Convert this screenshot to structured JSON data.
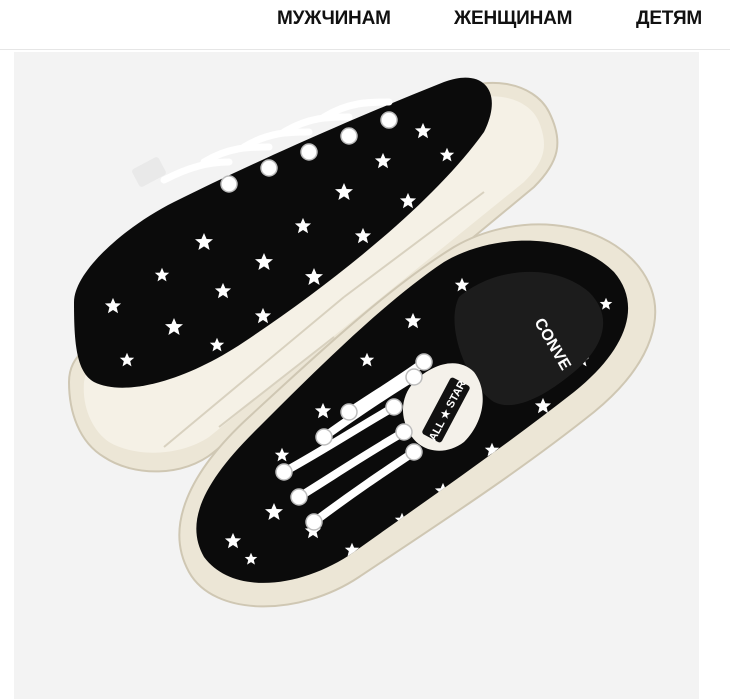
{
  "nav": {
    "items": [
      {
        "label": "МУЖЧИНАМ"
      },
      {
        "label": "ЖЕНЩИНАМ"
      },
      {
        "label": "ДЕТЯМ"
      }
    ]
  },
  "product": {
    "image_bg": "#f3f3f3",
    "tongue_label": "ALL ★ STAR",
    "tongue_brand": "CONVERSE",
    "insole_text": "CONVE",
    "colors": {
      "upper": "#0b0b0b",
      "sole": "#f2ede0",
      "stars": "#ffffff"
    }
  }
}
